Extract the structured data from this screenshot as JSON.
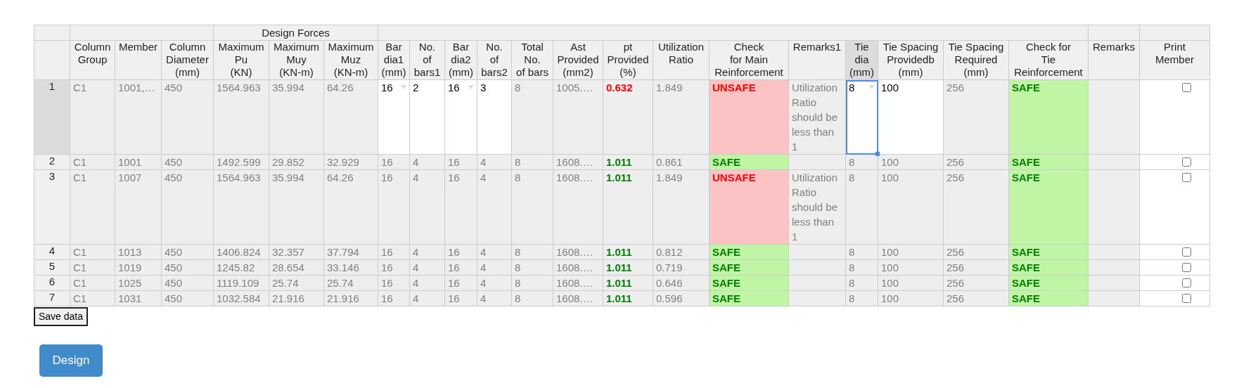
{
  "table": {
    "group_header": "Design Forces",
    "columns": [
      {
        "label": "Column\nGroup",
        "kind": "text",
        "selected": false
      },
      {
        "label": "Member",
        "kind": "text",
        "selected": false
      },
      {
        "label": "Column\nDiameter\n(mm)",
        "kind": "text",
        "selected": false
      },
      {
        "label": "Maximum\nPu\n(KN)",
        "kind": "text",
        "selected": false
      },
      {
        "label": "Maximum\nMuy\n(KN-m)",
        "kind": "text",
        "selected": false
      },
      {
        "label": "Maximum\nMuz\n(KN-m)",
        "kind": "text",
        "selected": false
      },
      {
        "label": "Bar\ndia1\n(mm)",
        "kind": "dropdown",
        "selected": false
      },
      {
        "label": "No.\nof\nbars1",
        "kind": "input",
        "selected": false
      },
      {
        "label": "Bar\ndia2\n(mm)",
        "kind": "dropdown",
        "selected": false
      },
      {
        "label": "No.\nof\nbars2",
        "kind": "input",
        "selected": false
      },
      {
        "label": "Total\nNo.\nof bars",
        "kind": "text",
        "selected": false
      },
      {
        "label": "Ast\nProvided\n(mm2)",
        "kind": "text",
        "selected": false
      },
      {
        "label": "pt\nProvided\n(%)",
        "kind": "pt",
        "selected": false
      },
      {
        "label": "Utilization\nRatio",
        "kind": "text",
        "selected": false
      },
      {
        "label": "Check\nfor Main\nReinforcement",
        "kind": "main_check",
        "selected": false
      },
      {
        "label": "Remarks1",
        "kind": "remark",
        "selected": false
      },
      {
        "label": "Tie\ndia\n(mm)",
        "kind": "dropdown",
        "selected": true
      },
      {
        "label": "Tie Spacing\nProvidedb\n(mm)",
        "kind": "input",
        "selected": false
      },
      {
        "label": "Tie Spacing\nRequired\n(mm)",
        "kind": "text",
        "selected": false
      },
      {
        "label": "Check for\nTie\nReinforcement",
        "kind": "tie_check",
        "selected": false
      },
      {
        "label": "Remarks",
        "kind": "empty",
        "selected": false
      },
      {
        "label": "Print\nMember",
        "kind": "checkbox",
        "selected": false
      }
    ],
    "rows": [
      {
        "number": "1",
        "selected": true,
        "editable": true,
        "pt_ok": false,
        "main_safe": false,
        "tie_safe": true,
        "print_checked": false,
        "cells": [
          "C1",
          "1001,…",
          "450",
          "1564.963",
          "35.994",
          "64.26",
          "16",
          "2",
          "16",
          "3",
          "8",
          "1005.…",
          "0.632",
          "1.849",
          "UNSAFE",
          "Utilization Ratio should be less than 1",
          "8",
          "100",
          "256",
          "SAFE"
        ]
      },
      {
        "number": "2",
        "selected": false,
        "editable": false,
        "pt_ok": true,
        "main_safe": true,
        "tie_safe": true,
        "print_checked": false,
        "cells": [
          "C1",
          "1001",
          "450",
          "1492.599",
          "29.852",
          "32.929",
          "16",
          "4",
          "16",
          "4",
          "8",
          "1608.…",
          "1.011",
          "0.861",
          "SAFE",
          "",
          "8",
          "100",
          "256",
          "SAFE"
        ]
      },
      {
        "number": "3",
        "selected": false,
        "editable": false,
        "pt_ok": true,
        "main_safe": false,
        "tie_safe": true,
        "print_checked": false,
        "cells": [
          "C1",
          "1007",
          "450",
          "1564.963",
          "35.994",
          "64.26",
          "16",
          "4",
          "16",
          "4",
          "8",
          "1608.…",
          "1.011",
          "1.849",
          "UNSAFE",
          "Utilization Ratio should be less than 1",
          "8",
          "100",
          "256",
          "SAFE"
        ]
      },
      {
        "number": "4",
        "selected": false,
        "editable": false,
        "pt_ok": true,
        "main_safe": true,
        "tie_safe": true,
        "print_checked": false,
        "cells": [
          "C1",
          "1013",
          "450",
          "1406.824",
          "32.357",
          "37.794",
          "16",
          "4",
          "16",
          "4",
          "8",
          "1608.…",
          "1.011",
          "0.812",
          "SAFE",
          "",
          "8",
          "100",
          "256",
          "SAFE"
        ]
      },
      {
        "number": "5",
        "selected": false,
        "editable": false,
        "pt_ok": true,
        "main_safe": true,
        "tie_safe": true,
        "print_checked": false,
        "cells": [
          "C1",
          "1019",
          "450",
          "1245.82",
          "28.654",
          "33.146",
          "16",
          "4",
          "16",
          "4",
          "8",
          "1608.…",
          "1.011",
          "0.719",
          "SAFE",
          "",
          "8",
          "100",
          "256",
          "SAFE"
        ]
      },
      {
        "number": "6",
        "selected": false,
        "editable": false,
        "pt_ok": true,
        "main_safe": true,
        "tie_safe": true,
        "print_checked": false,
        "cells": [
          "C1",
          "1025",
          "450",
          "1119.109",
          "25.74",
          "25.74",
          "16",
          "4",
          "16",
          "4",
          "8",
          "1608.…",
          "1.011",
          "0.646",
          "SAFE",
          "",
          "8",
          "100",
          "256",
          "SAFE"
        ]
      },
      {
        "number": "7",
        "selected": false,
        "editable": false,
        "pt_ok": true,
        "main_safe": true,
        "tie_safe": true,
        "print_checked": false,
        "cells": [
          "C1",
          "1031",
          "450",
          "1032.584",
          "21.916",
          "21.916",
          "16",
          "4",
          "16",
          "4",
          "8",
          "1608.…",
          "1.011",
          "0.596",
          "SAFE",
          "",
          "8",
          "100",
          "256",
          "SAFE"
        ]
      }
    ]
  },
  "save_button": "Save data",
  "design_button": "Design"
}
